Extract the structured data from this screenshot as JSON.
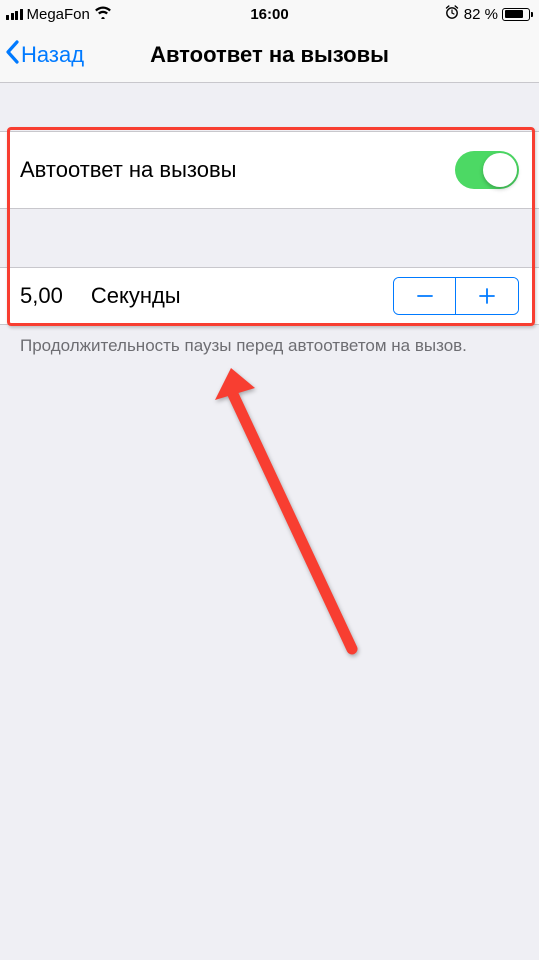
{
  "status_bar": {
    "carrier": "MegaFon",
    "time": "16:00",
    "battery_percent": "82 %"
  },
  "nav": {
    "back_label": "Назад",
    "title": "Автоответ на вызовы"
  },
  "settings": {
    "auto_answer_label": "Автоответ на вызовы",
    "auto_answer_on": true,
    "delay_value": "5,00",
    "delay_unit": "Секунды",
    "footer": "Продолжительность паузы перед автоответом на вызов."
  }
}
